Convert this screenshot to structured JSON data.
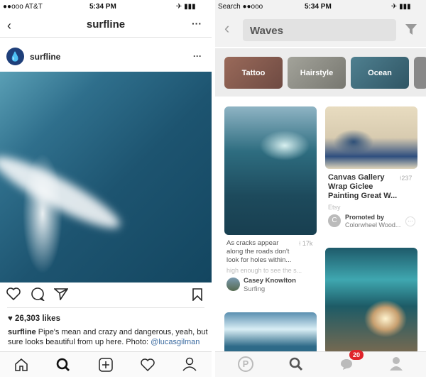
{
  "left": {
    "status": {
      "carrier": "●●ooo AT&T",
      "time": "5:34 PM"
    },
    "header": {
      "title": "surfline"
    },
    "post": {
      "username": "surfline",
      "likes": "26,303 likes",
      "caption_user": "surfline",
      "caption_text": " Pipe's mean and crazy and dangerous, yeah, but sure looks beautiful from up here. Photo: ",
      "caption_mention": "@lucasgilman"
    }
  },
  "right": {
    "status": {
      "carrier": "Search ●●ooo",
      "time": "5:34 PM"
    },
    "search": {
      "query": "Waves"
    },
    "categories": [
      {
        "label": "Tattoo",
        "color": "#8a5a4e"
      },
      {
        "label": "Hairstyle",
        "color": "#8c8c84"
      },
      {
        "label": "Ocean",
        "color": "#3b6878"
      }
    ],
    "pins": [
      {
        "description": "As cracks appear along the roads don't look for holes within...",
        "saves": "17k",
        "extra": "high enough to see the s...",
        "author": "Casey Knowlton",
        "board": "Surfing"
      },
      {
        "title": "Canvas Gallery Wrap Giclee Painting Great W...",
        "saves": "237",
        "source": "Etsy",
        "promoted_label": "Promoted by",
        "promoter": "Colorwheel Wood...",
        "promoter_initial": "C"
      }
    ],
    "notifications_badge": "20"
  }
}
